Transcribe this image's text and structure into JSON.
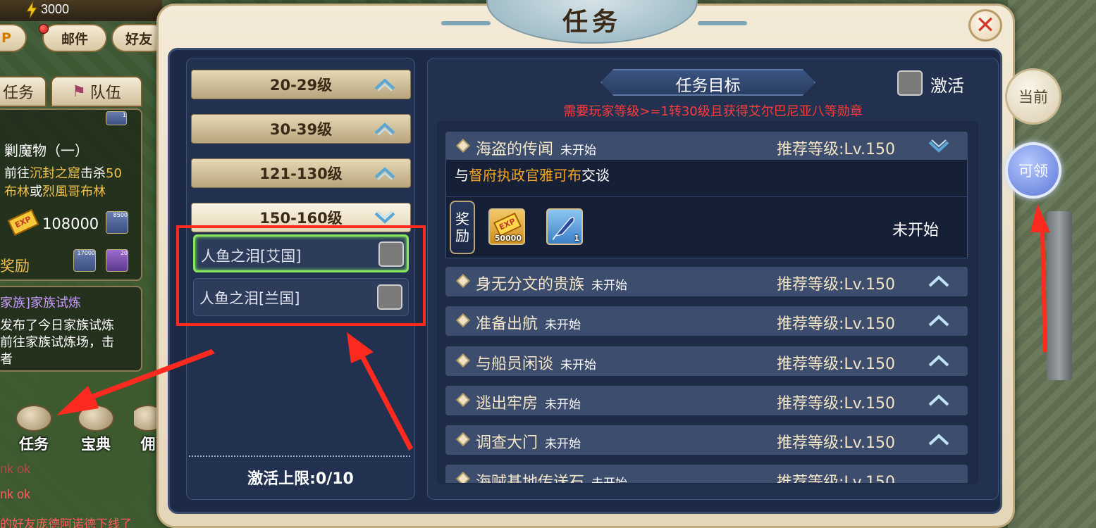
{
  "hud": {
    "gold": "3000",
    "mail_label": "邮件",
    "friends_label": "好友",
    "tab_quest": "任务",
    "tab_team": "队伍"
  },
  "left_panel": {
    "quest1_title": "剿魔物（一）",
    "quest1_line1_pre": "前往",
    "quest1_line1_place": "沉封之窟",
    "quest1_line1_post": "击杀",
    "quest1_line1_num": "50",
    "quest1_line2_a": "布林",
    "quest1_line2_or": "或",
    "quest1_line2_b": "烈風哥布林",
    "exp_value": "108000",
    "coin_count1": "8500",
    "reward_label": "奖励",
    "coin_count2": "17000",
    "item_count": "20",
    "top_count": "1",
    "quest2_title": "家族]家族试炼",
    "quest2_line1": "发布了今日家族试炼",
    "quest2_line2": "前往家族试炼场，击",
    "quest2_line3": "者"
  },
  "bottom_icons": {
    "quest": "任务",
    "codex": "宝典",
    "mercenary": "佣"
  },
  "chat": {
    "line1": "nk ok",
    "line2": "nk ok",
    "line3": "的好友庞德阿诺德下线了"
  },
  "dialog": {
    "title": "任务",
    "close_icon": "close-icon"
  },
  "levels": [
    {
      "label": "20-29级",
      "state": "collapsed"
    },
    {
      "label": "30-39级",
      "state": "collapsed"
    },
    {
      "label": "121-130级",
      "state": "collapsed"
    },
    {
      "label": "150-160级",
      "state": "expanded"
    }
  ],
  "sub_items": [
    {
      "label": "人鱼之泪[艾国]",
      "selected": true
    },
    {
      "label": "人鱼之泪[兰国]",
      "selected": false
    }
  ],
  "activation_limit": "激活上限:0/10",
  "objective": {
    "banner": "任务目标",
    "activate_label": "激活",
    "requirement": "需要玩家等级>=1转30级且获得艾尔巴尼亚八等勋章"
  },
  "quests": [
    {
      "name": "海盗的传闻",
      "status": "未开始",
      "level": "推荐等级:Lv.150",
      "expanded": true
    },
    {
      "name": "身无分文的贵族",
      "status": "未开始",
      "level": "推荐等级:Lv.150",
      "expanded": false
    },
    {
      "name": "准备出航",
      "status": "未开始",
      "level": "推荐等级:Lv.150",
      "expanded": false
    },
    {
      "name": "与船员闲谈",
      "status": "未开始",
      "level": "推荐等级:Lv.150",
      "expanded": false
    },
    {
      "name": "逃出牢房",
      "status": "未开始",
      "level": "推荐等级:Lv.150",
      "expanded": false
    },
    {
      "name": "调查大门",
      "status": "未开始",
      "level": "推荐等级:Lv.150",
      "expanded": false
    },
    {
      "name": "海贼基地传送石",
      "status": "未开始",
      "level": "推荐等级:Lv.150",
      "expanded": false
    }
  ],
  "expanded_detail": {
    "desc_pre": "与",
    "desc_npc": "督府执政官雅可布",
    "desc_post": "交谈",
    "reward_label": "奖励",
    "rewards": [
      {
        "icon": "exp-ticket-icon",
        "count": "50000"
      },
      {
        "icon": "feather-icon",
        "count": "1"
      }
    ],
    "status": "未开始"
  },
  "side_buttons": {
    "current": "当前",
    "claimable": "可领"
  },
  "colors": {
    "requirement": "#ff3a3a",
    "npc_highlight": "#f5a623",
    "selected_outline": "#86e85a",
    "annotation_red": "#ff2a1f"
  }
}
